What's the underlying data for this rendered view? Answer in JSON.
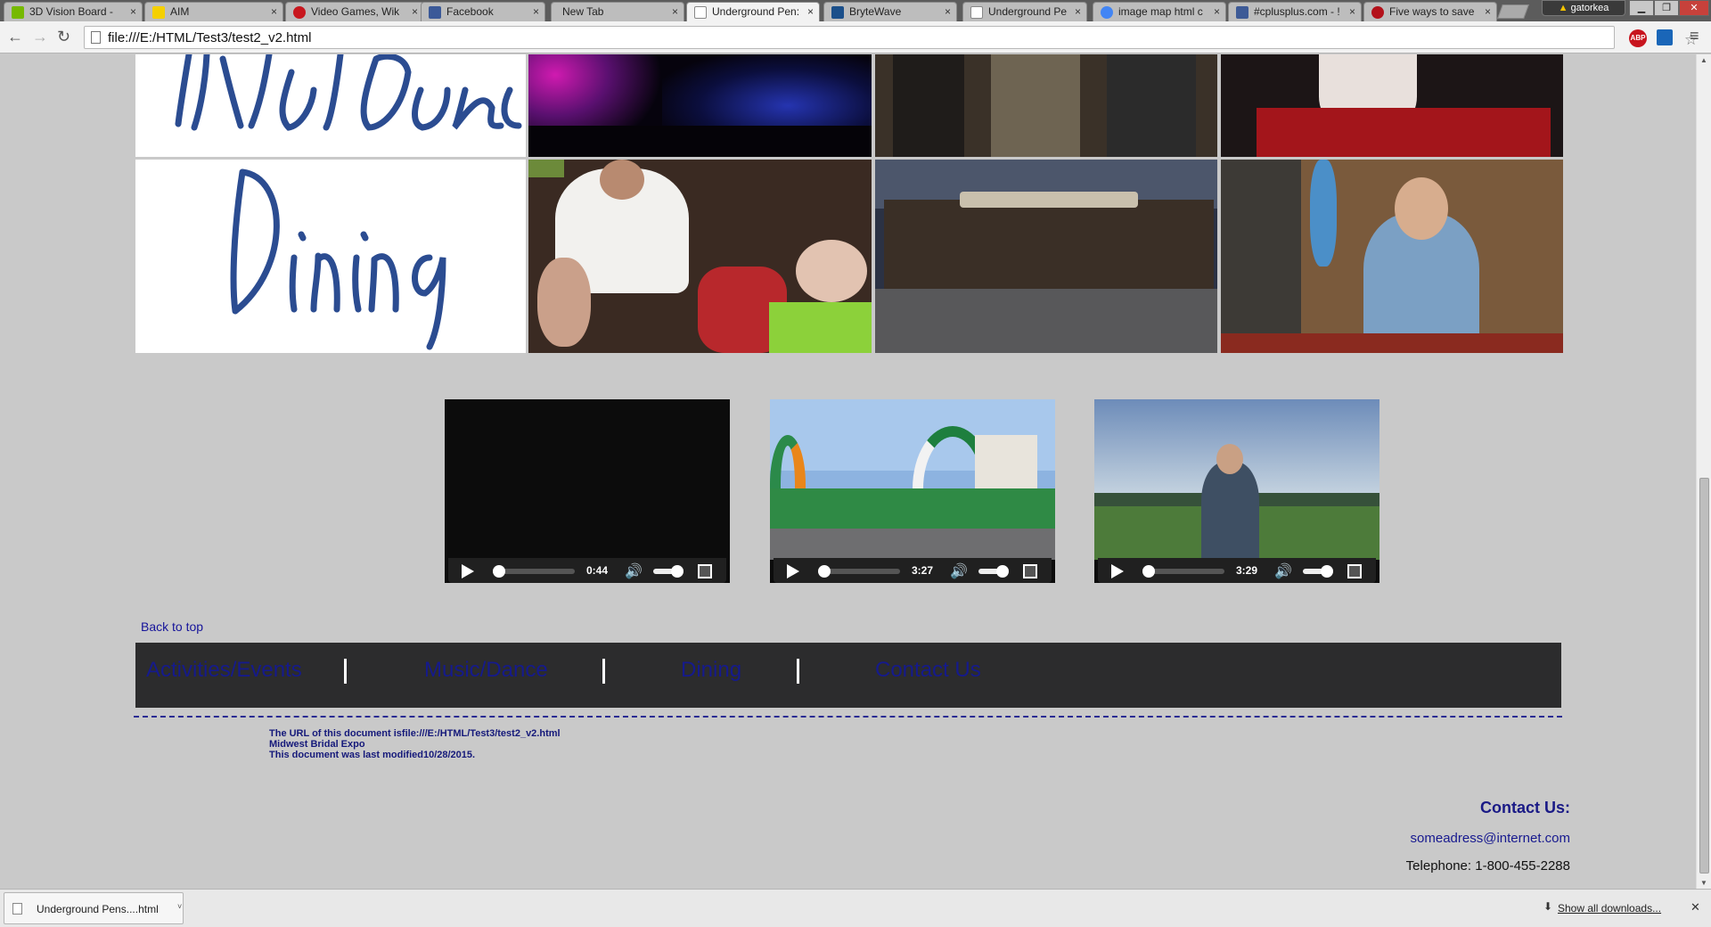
{
  "browser": {
    "tabs": [
      {
        "label": "3D Vision Board -",
        "icon": "nvidia-icon",
        "color": "#76b900",
        "active": false
      },
      {
        "label": "AIM",
        "icon": "aim-icon",
        "color": "#f5d000",
        "active": false
      },
      {
        "label": "Video Games, Wik",
        "icon": "wikia-icon",
        "color": "#c8171e",
        "active": false
      },
      {
        "label": "Facebook",
        "icon": "facebook-icon",
        "color": "#3b5998",
        "active": false
      },
      {
        "label": "New Tab",
        "icon": "",
        "color": "",
        "active": false
      },
      {
        "label": "Underground Pen:",
        "icon": "page-icon",
        "color": "#ffffff",
        "active": true
      },
      {
        "label": "BryteWave",
        "icon": "brytewave-icon",
        "color": "#1b4f8a",
        "active": false
      },
      {
        "label": "Underground Pen:",
        "icon": "page-icon",
        "color": "#ffffff",
        "active": false
      },
      {
        "label": "image map html c",
        "icon": "google-icon",
        "color": "#4285f4",
        "active": false
      },
      {
        "label": "#cplusplus.com - !",
        "icon": "cplusplus-icon",
        "color": "#3d5a96",
        "active": false
      },
      {
        "label": "Five ways to save",
        "icon": "cnet-icon",
        "color": "#b3111a",
        "active": false
      }
    ],
    "tab_close_glyph": "×",
    "user_name": "gatorkea",
    "window_controls": {
      "minimize": "▁",
      "restore": "❐",
      "close": "✕"
    },
    "nav": {
      "back_glyph": "←",
      "forward_glyph": "→",
      "reload_glyph": "↻",
      "menu_glyph": "≡"
    },
    "address": "file:///E:/HTML/Test3/test2_v2.html",
    "star_glyph": "☆",
    "abp_label": "ABP"
  },
  "gallery": {
    "rows": [
      {
        "label": "Music Dance",
        "photos": [
          "club-crowd-photo",
          "band-members-photo",
          "clown-face-rappers-photo"
        ]
      },
      {
        "label": "Dining",
        "photos": [
          "chef-serving-kids-photo",
          "restaurant-exterior-photo",
          "bartender-photo"
        ]
      }
    ]
  },
  "videos": [
    {
      "name": "video-player-1",
      "time": "0:44",
      "progress": 0.0,
      "volume": 0.6
    },
    {
      "name": "video-player-2",
      "time": "3:27",
      "progress": 0.0,
      "volume": 0.6
    },
    {
      "name": "video-player-3",
      "time": "3:29",
      "progress": 0.0,
      "volume": 0.6
    }
  ],
  "back_to_top": "Back to top",
  "navbar": {
    "links": [
      "Activities/Events",
      "Music/Dance",
      "Dining",
      "Contact Us"
    ]
  },
  "footer": {
    "url_line": "The URL of this document isfile:///E:/HTML/Test3/test2_v2.html",
    "org_line": "Midwest Bridal Expo",
    "modified_line": "This document was last modified10/28/2015."
  },
  "contact": {
    "heading": "Contact Us:",
    "email": "someadress@internet.com",
    "telephone": "Telephone: 1-800-455-2288"
  },
  "downloads": {
    "item": "Underground Pens....html",
    "caret": "˅",
    "show_all": "Show all downloads...",
    "close_glyph": "✕"
  },
  "colors": {
    "page_bg": "#c9c9c9",
    "navbar_bg": "#2c2c2d",
    "link": "#151a8c",
    "script_text": "#2b4c91"
  }
}
